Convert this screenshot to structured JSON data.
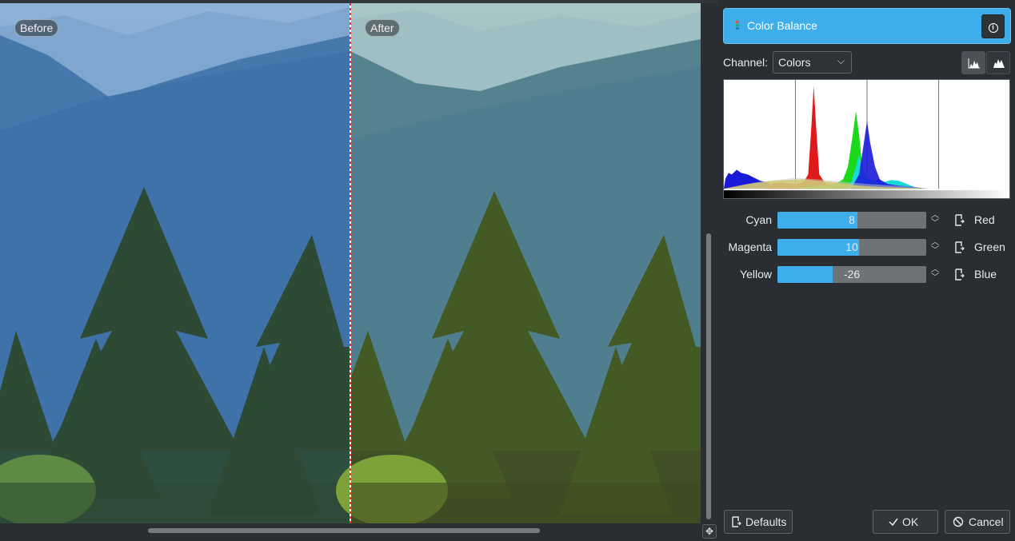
{
  "preview": {
    "before_label": "Before",
    "after_label": "After"
  },
  "panel": {
    "title": "Color Balance",
    "info_icon": "info-icon",
    "channel_label": "Channel:",
    "channel_value": "Colors",
    "histogram_modes": [
      "linear-histogram-icon",
      "logarithmic-histogram-icon"
    ],
    "sliders": [
      {
        "left": "Cyan",
        "right": "Red",
        "value": "8",
        "min": -100,
        "max": 100
      },
      {
        "left": "Magenta",
        "right": "Green",
        "value": "10",
        "min": -100,
        "max": 100
      },
      {
        "left": "Yellow",
        "right": "Blue",
        "value": "-26",
        "min": -100,
        "max": 100
      }
    ]
  },
  "buttons": {
    "defaults": "Defaults",
    "ok": "OK",
    "cancel": "Cancel"
  },
  "colors": {
    "accent": "#3daee9",
    "panel_bg": "#2a2e32"
  }
}
